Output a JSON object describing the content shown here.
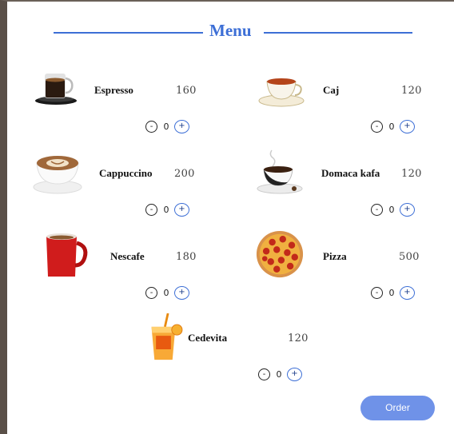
{
  "menu": {
    "title": "Menu",
    "order_label": "Order",
    "accent_color": "#3d6fd6",
    "items": [
      {
        "name": "Espresso",
        "price": "160",
        "qty": "0",
        "icon": "espresso-cup-icon"
      },
      {
        "name": "Caj",
        "price": "120",
        "qty": "0",
        "icon": "tea-cup-icon"
      },
      {
        "name": "Cappuccino",
        "price": "200",
        "qty": "0",
        "icon": "cappuccino-cup-icon"
      },
      {
        "name": "Domaca kafa",
        "price": "120",
        "qty": "0",
        "icon": "coffee-cup-icon"
      },
      {
        "name": "Nescafe",
        "price": "180",
        "qty": "0",
        "icon": "nescafe-mug-icon"
      },
      {
        "name": "Pizza",
        "price": "500",
        "qty": "0",
        "icon": "pizza-icon"
      },
      {
        "name": "Cedevita",
        "price": "120",
        "qty": "0",
        "icon": "orange-drink-icon"
      }
    ],
    "minus_label": "-",
    "plus_label": "+"
  }
}
